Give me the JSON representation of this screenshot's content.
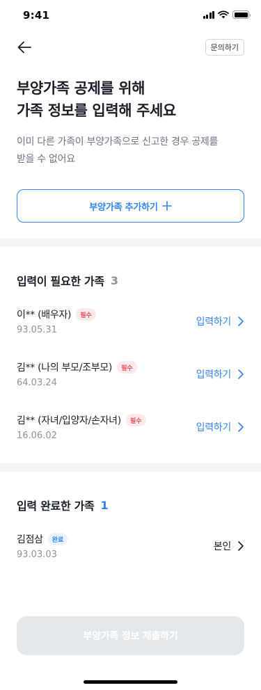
{
  "status_bar": {
    "time": "9:41"
  },
  "nav": {
    "inquiry_label": "문의하기"
  },
  "headline": {
    "line1": "부양가족 공제를 위해",
    "line2": "가족 정보를 입력해 주세요"
  },
  "subtext": {
    "line1": "이미 다른 가족이 부양가족으로 신고한 경우 공제를",
    "line2": "받을 수 없어요"
  },
  "add_button": {
    "label": "부양가족 추가하기"
  },
  "pending_section": {
    "title": "입력이 필요한 가족",
    "count": "3",
    "items": [
      {
        "name": "이** (배우자)",
        "badge": "필수",
        "date": "93.05.31",
        "action": "입력하기"
      },
      {
        "name": "김** (나의 부모/조부모)",
        "badge": "필수",
        "date": "64.03.24",
        "action": "입력하기"
      },
      {
        "name": "김** (자녀/입양자/손자녀)",
        "badge": "필수",
        "date": "16.06.02",
        "action": "입력하기"
      }
    ]
  },
  "done_section": {
    "title": "입력 완료한 가족",
    "count": "1",
    "items": [
      {
        "name": "김점삼",
        "badge": "완료",
        "date": "93.03.03",
        "action": "본인"
      }
    ]
  },
  "submit_button": {
    "label": "부양가족 정보 제출하기"
  },
  "colors": {
    "accent": "#3182f6",
    "required_badge_bg": "#fde9e9",
    "required_badge_text": "#e8505b",
    "done_badge_bg": "#e8f3ff",
    "disabled_button": "#e5e8eb"
  }
}
